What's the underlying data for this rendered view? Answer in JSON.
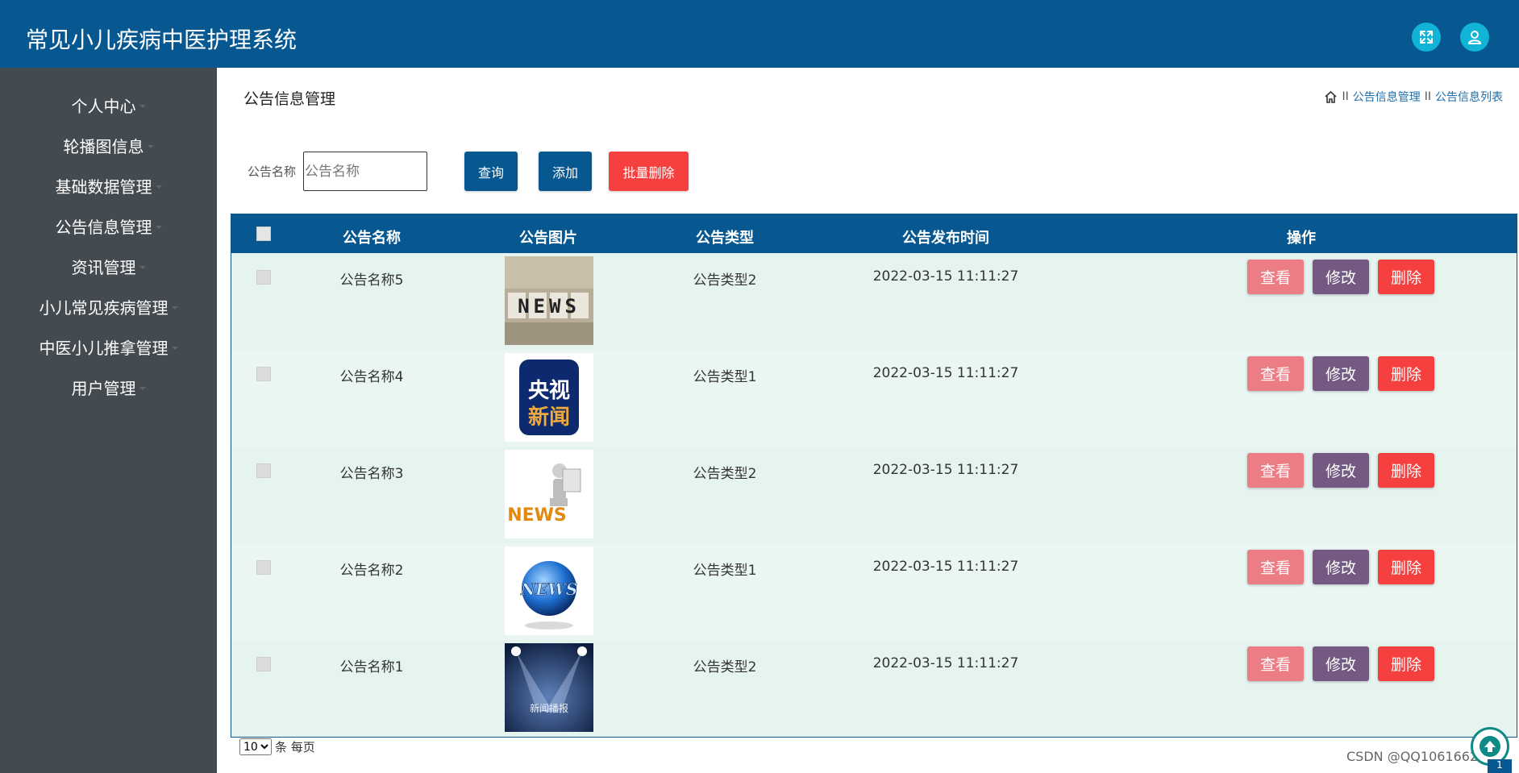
{
  "app": {
    "title": "常见小儿疾病中医护理系统"
  },
  "header": {
    "fullscreen_icon": "expand-icon",
    "user_icon": "user-icon"
  },
  "sidebar": {
    "items": [
      {
        "label": "个人中心"
      },
      {
        "label": "轮播图信息"
      },
      {
        "label": "基础数据管理"
      },
      {
        "label": "公告信息管理"
      },
      {
        "label": "资讯管理"
      },
      {
        "label": "小儿常见疾病管理"
      },
      {
        "label": "中医小儿推拿管理"
      },
      {
        "label": "用户管理"
      }
    ]
  },
  "page": {
    "title": "公告信息管理",
    "breadcrumb": {
      "sep1": "II",
      "item1": "公告信息管理",
      "sep2": "II",
      "item2": "公告信息列表"
    }
  },
  "search": {
    "label": "公告名称",
    "placeholder": "公告名称",
    "value": "",
    "query_label": "查询",
    "add_label": "添加",
    "batch_delete_label": "批量删除"
  },
  "table": {
    "headers": {
      "name": "公告名称",
      "image": "公告图片",
      "type": "公告类型",
      "time": "公告发布时间",
      "actions": "操作"
    },
    "rows": [
      {
        "name": "公告名称5",
        "type": "公告类型2",
        "time": "2022-03-15 11:11:27",
        "image_text": "NEWS"
      },
      {
        "name": "公告名称4",
        "type": "公告类型1",
        "time": "2022-03-15 11:11:27",
        "image_text": "央视新闻"
      },
      {
        "name": "公告名称3",
        "type": "公告类型2",
        "time": "2022-03-15 11:11:27",
        "image_text": "NEWS"
      },
      {
        "name": "公告名称2",
        "type": "公告类型1",
        "time": "2022-03-15 11:11:27",
        "image_text": "NEWS"
      },
      {
        "name": "公告名称1",
        "type": "公告类型2",
        "time": "2022-03-15 11:11:27",
        "image_text": "新闻播报"
      }
    ],
    "actions": {
      "view": "查看",
      "edit": "修改",
      "delete": "删除"
    }
  },
  "pagination": {
    "page_size": "10",
    "page_size_suffix": "条 每页",
    "current_page": "1"
  },
  "watermark": "CSDN @QQ1061662411",
  "colors": {
    "header": "#075891",
    "sidebar": "#434a50",
    "view": "#ec7d85",
    "edit": "#745a83",
    "delete": "#f6403f",
    "batch_delete": "#f6403f",
    "query": "#075891"
  }
}
